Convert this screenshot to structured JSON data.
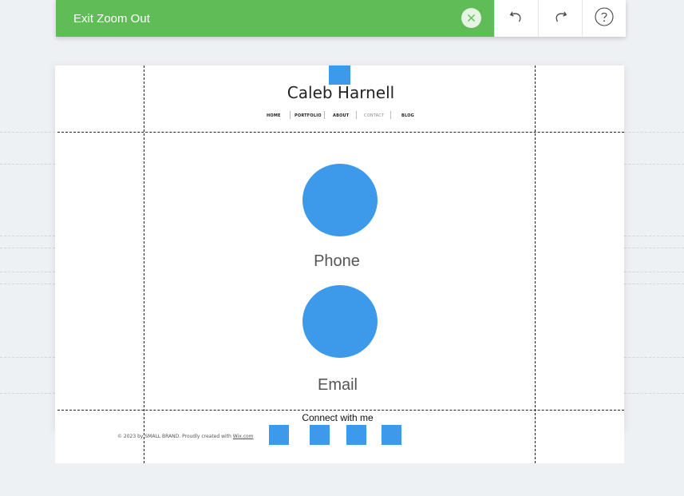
{
  "toolbar": {
    "exit_zoom_label": "Exit Zoom Out",
    "accent_color": "#60bc57",
    "close_icon": "close-icon",
    "undo_icon": "undo-icon",
    "redo_icon": "redo-icon",
    "help_icon": "help-icon"
  },
  "site": {
    "title": "Caleb Harnell",
    "nav": [
      "HOME",
      "PORTFOLIO",
      "ABOUT",
      "CONTACT",
      "BLOG"
    ],
    "active_nav": "CONTACT"
  },
  "sections": {
    "phone_label": "Phone",
    "email_label": "Email"
  },
  "footer": {
    "connect_label": "Connect with me",
    "copyright_prefix": "© 2023 by SMALL BRAND. Proudly created with ",
    "copyright_link": "Wix.com"
  },
  "colors": {
    "placeholder_blue": "#3d99e9",
    "canvas_background": "#ffffff",
    "editor_background": "#eef1f4"
  }
}
